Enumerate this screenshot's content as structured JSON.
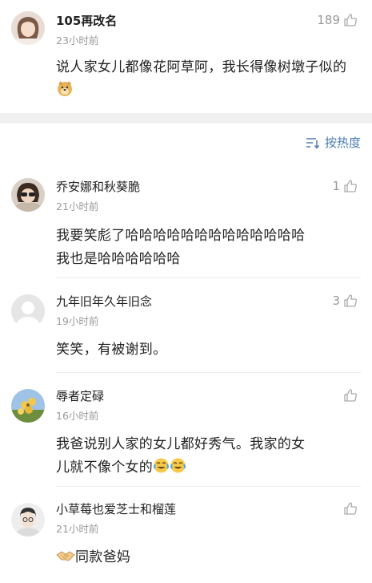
{
  "post": {
    "username": "105再改名",
    "time": "23小时前",
    "likes": "189",
    "text_main": "说人家女儿都像花阿草阿，我长得像树墩子似的",
    "emoji": "doge-emoji"
  },
  "sort": {
    "label": "按热度",
    "icon": "sort-icon"
  },
  "comments": [
    {
      "username": "乔安娜和秋葵脆",
      "time": "21小时前",
      "likes": "1",
      "line1": "我要笑彪了哈哈哈哈哈哈哈哈哈哈哈哈哈",
      "line2": "我也是哈哈哈哈哈哈"
    },
    {
      "username": "九年旧年久年旧念",
      "time": "19小时前",
      "likes": "3",
      "line1": "笑笑，有被谢到。"
    },
    {
      "username": "辱者定碌",
      "time": "16小时前",
      "likes": "",
      "line1": "我爸说别人家的女儿都好秀气。我家的女",
      "line2": "儿就不像个女的",
      "emoji": "laugh-cry-emoji"
    },
    {
      "username": "小草莓也爱芝士和榴莲",
      "time": "21小时前",
      "likes": "",
      "line1": "同款爸妈",
      "emoji": "handshake-emoji"
    }
  ],
  "colors": {
    "accent": "#4b7cb3",
    "muted": "#999999",
    "divider": "#f0f0f0"
  }
}
